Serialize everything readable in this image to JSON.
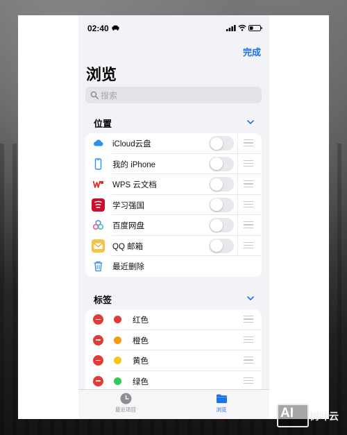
{
  "status_bar": {
    "time": "02:40"
  },
  "header": {
    "done_label": "完成",
    "title": "浏览"
  },
  "search": {
    "placeholder": "搜索"
  },
  "locations": {
    "title": "位置",
    "items": [
      {
        "label": "iCloud云盘",
        "icon": "icloud-icon"
      },
      {
        "label": "我的 iPhone",
        "icon": "iphone-icon"
      },
      {
        "label": "WPS 云文档",
        "icon": "wps-icon"
      },
      {
        "label": "学习强国",
        "icon": "xuexi-qiangguo-icon"
      },
      {
        "label": "百度网盘",
        "icon": "baidu-netdisk-icon"
      },
      {
        "label": "QQ 邮箱",
        "icon": "qq-mail-icon"
      },
      {
        "label": "最近删除",
        "icon": "trash-icon"
      }
    ]
  },
  "tags": {
    "title": "标签",
    "items": [
      {
        "label": "红色",
        "color": "#e53935"
      },
      {
        "label": "橙色",
        "color": "#f39c12"
      },
      {
        "label": "黄色",
        "color": "#f5c518"
      },
      {
        "label": "绿色",
        "color": "#34c759"
      }
    ]
  },
  "tabbar": {
    "tabs": [
      {
        "label": "最近项目",
        "icon": "clock-icon"
      },
      {
        "label": "浏览",
        "icon": "folder-icon"
      }
    ],
    "active_color": "#1a73e8",
    "inactive_color": "#8e8e93"
  },
  "watermark": {
    "badge": "AI",
    "text": "树叶云"
  }
}
